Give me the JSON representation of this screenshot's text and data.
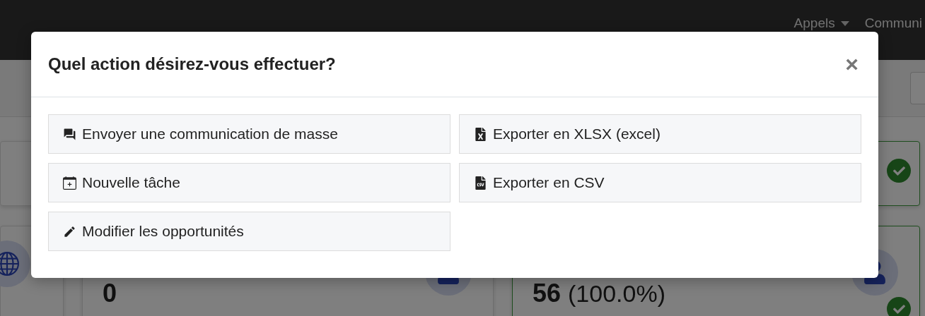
{
  "navbar": {
    "items": [
      {
        "label": "Appels",
        "has_caret": true
      },
      {
        "label": "Communi",
        "has_caret": false
      }
    ]
  },
  "background_stats": [
    {
      "value": "0"
    },
    {
      "value": "56",
      "suffix": "(100.0%)"
    }
  ],
  "modal": {
    "title": "Quel action désirez-vous effectuer?",
    "close": "×",
    "left_actions": [
      "Envoyer une communication de masse",
      "Nouvelle tâche",
      "Modifier les opportunités"
    ],
    "right_actions": [
      "Exporter en XLSX (excel)",
      "Exporter en CSV"
    ]
  }
}
